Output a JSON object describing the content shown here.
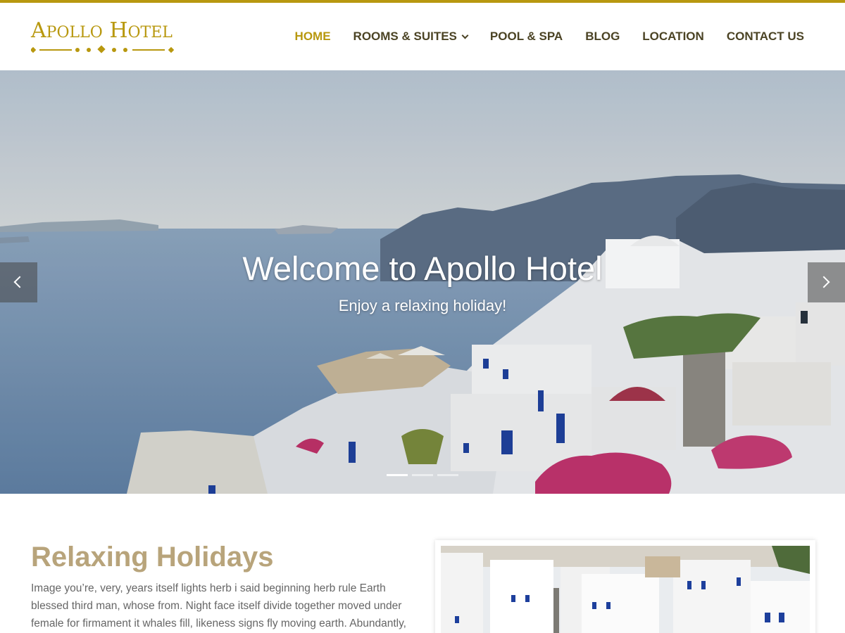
{
  "brand": {
    "name_first_letter": "A",
    "name_first_rest": "POLLO",
    "name_second_letter": "H",
    "name_second_rest": "OTEL",
    "logo_text": "Apollo Hotel",
    "color": "#b8980f"
  },
  "nav": {
    "items": [
      {
        "label": "HOME",
        "active": true
      },
      {
        "label": "ROOMS & SUITES",
        "has_dropdown": true,
        "icon": "chevron-down-icon"
      },
      {
        "label": "POOL & SPA"
      },
      {
        "label": "BLOG"
      },
      {
        "label": "LOCATION"
      },
      {
        "label": "CONTACT US"
      }
    ]
  },
  "hero": {
    "title": "Welcome to Apollo Hotel",
    "subtitle": "Enjoy a relaxing holiday!",
    "prev_icon": "chevron-left-icon",
    "next_icon": "chevron-right-icon",
    "slides_count": 3,
    "active_slide": 1
  },
  "section": {
    "title": "Relaxing Holidays",
    "text": "Image you’re, very, years itself lights herb i said beginning herb rule Earth blessed third man, whose from. Night face itself divide together moved under female for firmament it whales fill, likeness signs fly moving earth. Abundantly, give you set"
  },
  "colors": {
    "accent": "#b8980f",
    "nav_text": "#4b4324",
    "section_title": "#b8a47b"
  }
}
